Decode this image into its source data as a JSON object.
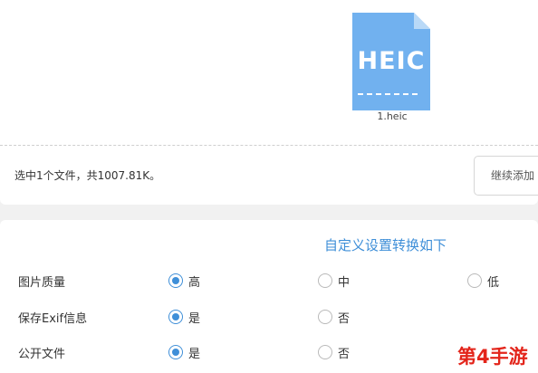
{
  "upload": {
    "file": {
      "icon_text": "HEIC",
      "name": "1.heic"
    },
    "summary": "选中1个文件，共1007.81K。",
    "add_button_label": "继续添加"
  },
  "settings": {
    "title": "自定义设置转换如下",
    "rows": [
      {
        "label": "图片质量",
        "options": [
          "高",
          "中",
          "低"
        ],
        "selected": "高"
      },
      {
        "label": "保存Exif信息",
        "options": [
          "是",
          "否"
        ],
        "selected": "是"
      },
      {
        "label": "公开文件",
        "options": [
          "是",
          "否"
        ],
        "selected": "是"
      }
    ]
  },
  "watermark": "第4手游",
  "colors": {
    "accent": "#3f8fd8",
    "file_icon": "#71b1ef",
    "watermark": "#e3251b"
  }
}
